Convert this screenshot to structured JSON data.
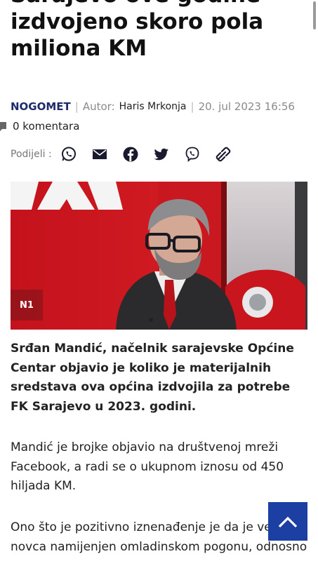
{
  "article": {
    "title_lines": [
      "Sarajevo ove godine",
      "izdvojeno skoro pola",
      "miliona KM"
    ],
    "category": "NOGOMET",
    "author_label": "Autor:",
    "author_name": "Haris Mrkonja",
    "date": "20. jul 2023 16:56",
    "comments": "0 komentara",
    "share_label": "Podijeli :",
    "share_icons": [
      "whatsapp-icon",
      "email-icon",
      "facebook-icon",
      "twitter-icon",
      "viber-icon",
      "copy-link-icon"
    ],
    "image_credit": "N1",
    "lead": "Srđan Mandić, načelnik sarajevske Općine Centar objavio je koliko je materijalnih sredstava ova općina izdvojila za potrebe FK Sarajevo u 2023. godini.",
    "paragraph_1": "Mandić je brojke objavio na društvenoj mreži Facebook, a radi se o ukupnom iznosu od 450 hiljada KM.",
    "paragraph_2": "Ono što je pozitivno iznenađenje je da je veći dio novca namijenjen omladinskom pogonu, odnosno"
  },
  "colors": {
    "category": "#1f2a6b",
    "back_to_top": "#1b3fa3"
  }
}
